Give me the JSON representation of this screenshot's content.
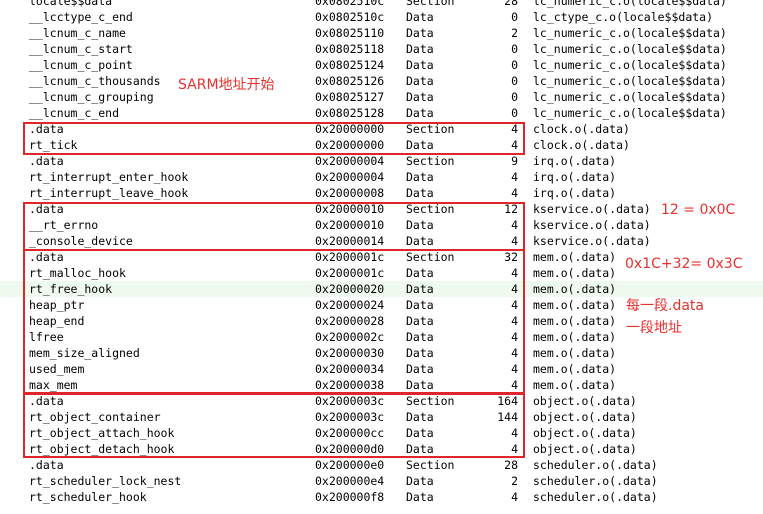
{
  "rows": [
    {
      "name": "locale$$data",
      "addr": "0x0802510c",
      "type": "Section",
      "size": "28",
      "obj": "lc_numeric_c.o(locale$$data)"
    },
    {
      "name": "__lcctype_c_end",
      "addr": "0x0802510c",
      "type": "Data",
      "size": "0",
      "obj": "lc_ctype_c.o(locale$$data)"
    },
    {
      "name": "__lcnum_c_name",
      "addr": "0x08025110",
      "type": "Data",
      "size": "2",
      "obj": "lc_numeric_c.o(locale$$data)"
    },
    {
      "name": "__lcnum_c_start",
      "addr": "0x08025118",
      "type": "Data",
      "size": "0",
      "obj": "lc_numeric_c.o(locale$$data)"
    },
    {
      "name": "__lcnum_c_point",
      "addr": "0x08025124",
      "type": "Data",
      "size": "0",
      "obj": "lc_numeric_c.o(locale$$data)"
    },
    {
      "name": "__lcnum_c_thousands",
      "addr": "0x08025126",
      "type": "Data",
      "size": "0",
      "obj": "lc_numeric_c.o(locale$$data)"
    },
    {
      "name": "__lcnum_c_grouping",
      "addr": "0x08025127",
      "type": "Data",
      "size": "0",
      "obj": "lc_numeric_c.o(locale$$data)"
    },
    {
      "name": "__lcnum_c_end",
      "addr": "0x08025128",
      "type": "Data",
      "size": "0",
      "obj": "lc_numeric_c.o(locale$$data)"
    },
    {
      "name": ".data",
      "addr": "0x20000000",
      "type": "Section",
      "size": "4",
      "obj": "clock.o(.data)"
    },
    {
      "name": "rt_tick",
      "addr": "0x20000000",
      "type": "Data",
      "size": "4",
      "obj": "clock.o(.data)"
    },
    {
      "name": ".data",
      "addr": "0x20000004",
      "type": "Section",
      "size": "9",
      "obj": "irq.o(.data)"
    },
    {
      "name": "rt_interrupt_enter_hook",
      "addr": "0x20000004",
      "type": "Data",
      "size": "4",
      "obj": "irq.o(.data)"
    },
    {
      "name": "rt_interrupt_leave_hook",
      "addr": "0x20000008",
      "type": "Data",
      "size": "4",
      "obj": "irq.o(.data)"
    },
    {
      "name": ".data",
      "addr": "0x20000010",
      "type": "Section",
      "size": "12",
      "obj": "kservice.o(.data)"
    },
    {
      "name": "__rt_errno",
      "addr": "0x20000010",
      "type": "Data",
      "size": "4",
      "obj": "kservice.o(.data)"
    },
    {
      "name": "_console_device",
      "addr": "0x20000014",
      "type": "Data",
      "size": "4",
      "obj": "kservice.o(.data)"
    },
    {
      "name": ".data",
      "addr": "0x2000001c",
      "type": "Section",
      "size": "32",
      "obj": "mem.o(.data)"
    },
    {
      "name": "rt_malloc_hook",
      "addr": "0x2000001c",
      "type": "Data",
      "size": "4",
      "obj": "mem.o(.data)"
    },
    {
      "name": "rt_free_hook",
      "addr": "0x20000020",
      "type": "Data",
      "size": "4",
      "obj": "mem.o(.data)",
      "highlight": true
    },
    {
      "name": "heap_ptr",
      "addr": "0x20000024",
      "type": "Data",
      "size": "4",
      "obj": "mem.o(.data)"
    },
    {
      "name": "heap_end",
      "addr": "0x20000028",
      "type": "Data",
      "size": "4",
      "obj": "mem.o(.data)"
    },
    {
      "name": "lfree",
      "addr": "0x2000002c",
      "type": "Data",
      "size": "4",
      "obj": "mem.o(.data)"
    },
    {
      "name": "mem_size_aligned",
      "addr": "0x20000030",
      "type": "Data",
      "size": "4",
      "obj": "mem.o(.data)"
    },
    {
      "name": "used_mem",
      "addr": "0x20000034",
      "type": "Data",
      "size": "4",
      "obj": "mem.o(.data)"
    },
    {
      "name": "max_mem",
      "addr": "0x20000038",
      "type": "Data",
      "size": "4",
      "obj": "mem.o(.data)"
    },
    {
      "name": ".data",
      "addr": "0x2000003c",
      "type": "Section",
      "size": "164",
      "obj": "object.o(.data)"
    },
    {
      "name": "rt_object_container",
      "addr": "0x2000003c",
      "type": "Data",
      "size": "144",
      "obj": "object.o(.data)"
    },
    {
      "name": "rt_object_attach_hook",
      "addr": "0x200000cc",
      "type": "Data",
      "size": "4",
      "obj": "object.o(.data)"
    },
    {
      "name": "rt_object_detach_hook",
      "addr": "0x200000d0",
      "type": "Data",
      "size": "4",
      "obj": "object.o(.data)"
    },
    {
      "name": ".data",
      "addr": "0x200000e0",
      "type": "Section",
      "size": "28",
      "obj": "scheduler.o(.data)"
    },
    {
      "name": "rt_scheduler_lock_nest",
      "addr": "0x200000e4",
      "type": "Data",
      "size": "2",
      "obj": "scheduler.o(.data)"
    },
    {
      "name": "rt_scheduler_hook",
      "addr": "0x200000f8",
      "type": "Data",
      "size": "4",
      "obj": "scheduler.o(.data)"
    }
  ],
  "annotations": {
    "sram_start": "SARM地址开始",
    "kservice_size": "12 = 0x0C",
    "mem_end": "0x1C+32= 0x3C",
    "each_data_line1": "每一段.data",
    "each_data_line2": "一段地址"
  },
  "colors": {
    "annotation": "#e8312e",
    "box_border": "#e0262a",
    "row_highlight": "#eefaee"
  }
}
